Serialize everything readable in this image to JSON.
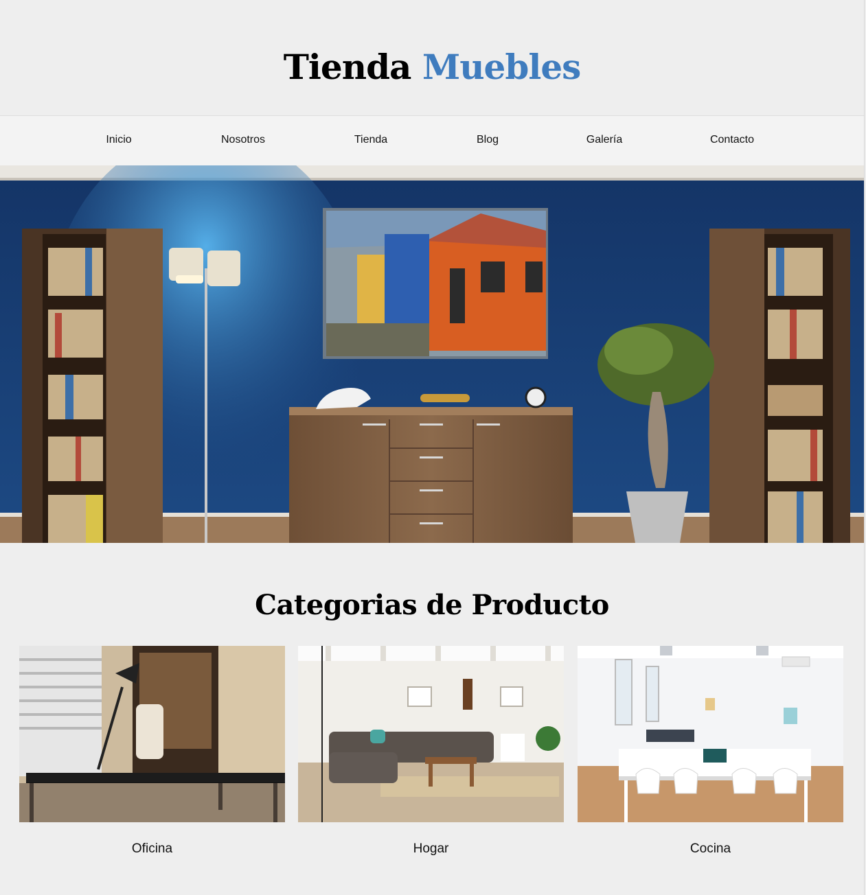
{
  "header": {
    "brand_part1": "Tienda",
    "brand_part2": "Muebles",
    "accent_color": "#3f7cbe"
  },
  "nav": {
    "items": [
      "Inicio",
      "Nosotros",
      "Tienda",
      "Blog",
      "Galería",
      "Contacto"
    ]
  },
  "hero": {
    "image": "living room with blue wall, wooden dresser, bookshelves, floor lamp, tree plant and a painting of colorful houses"
  },
  "categories": {
    "title": "Categorias de Producto",
    "items": [
      {
        "label": "Oficina",
        "image": "office desk with lamp and chair"
      },
      {
        "label": "Hogar",
        "image": "living room with sofa and coffee table"
      },
      {
        "label": "Cocina",
        "image": "white dining table with chairs"
      }
    ]
  }
}
